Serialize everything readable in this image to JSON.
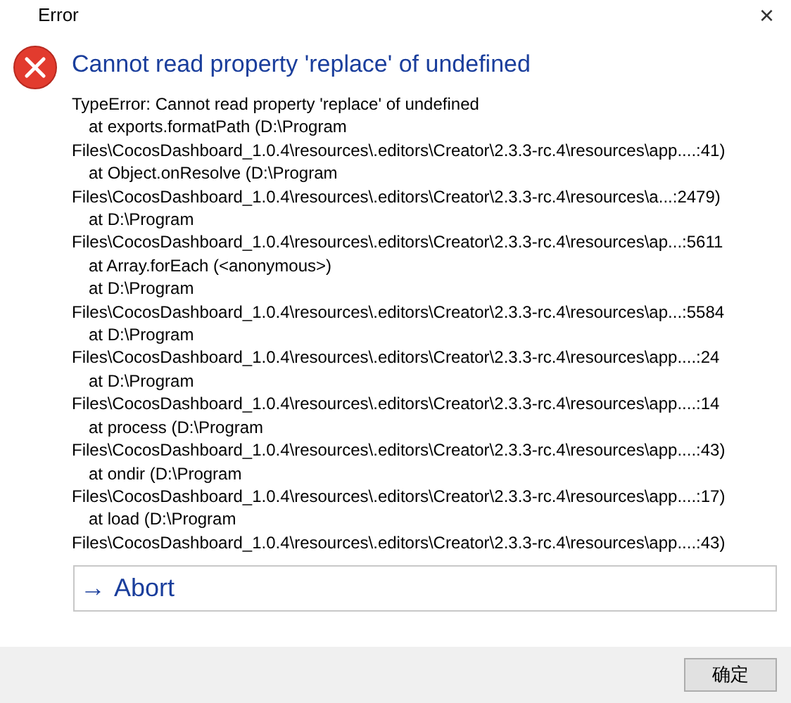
{
  "window": {
    "title": "Error",
    "close": "×"
  },
  "heading": "Cannot read property 'replace' of undefined",
  "details": [
    {
      "kind": "message",
      "text": "TypeError: Cannot read property 'replace' of undefined"
    },
    {
      "kind": "frame",
      "text": "at exports.formatPath (D:\\Program"
    },
    {
      "kind": "path",
      "text": "Files\\CocosDashboard_1.0.4\\resources\\.editors\\Creator\\2.3.3-rc.4\\resources\\app....:41)"
    },
    {
      "kind": "frame",
      "text": "at Object.onResolve (D:\\Program"
    },
    {
      "kind": "path",
      "text": "Files\\CocosDashboard_1.0.4\\resources\\.editors\\Creator\\2.3.3-rc.4\\resources\\a...:2479)"
    },
    {
      "kind": "frame",
      "text": "at D:\\Program"
    },
    {
      "kind": "path",
      "text": "Files\\CocosDashboard_1.0.4\\resources\\.editors\\Creator\\2.3.3-rc.4\\resources\\ap...:5611"
    },
    {
      "kind": "frame",
      "text": "at Array.forEach (<anonymous>)"
    },
    {
      "kind": "frame",
      "text": "at D:\\Program"
    },
    {
      "kind": "path",
      "text": "Files\\CocosDashboard_1.0.4\\resources\\.editors\\Creator\\2.3.3-rc.4\\resources\\ap...:5584"
    },
    {
      "kind": "frame",
      "text": "at D:\\Program"
    },
    {
      "kind": "path",
      "text": "Files\\CocosDashboard_1.0.4\\resources\\.editors\\Creator\\2.3.3-rc.4\\resources\\app....:24"
    },
    {
      "kind": "frame",
      "text": "at D:\\Program"
    },
    {
      "kind": "path",
      "text": "Files\\CocosDashboard_1.0.4\\resources\\.editors\\Creator\\2.3.3-rc.4\\resources\\app....:14"
    },
    {
      "kind": "frame",
      "text": "at process (D:\\Program"
    },
    {
      "kind": "path",
      "text": "Files\\CocosDashboard_1.0.4\\resources\\.editors\\Creator\\2.3.3-rc.4\\resources\\app....:43)"
    },
    {
      "kind": "frame",
      "text": "at ondir (D:\\Program"
    },
    {
      "kind": "path",
      "text": "Files\\CocosDashboard_1.0.4\\resources\\.editors\\Creator\\2.3.3-rc.4\\resources\\app....:17)"
    },
    {
      "kind": "frame",
      "text": "at load (D:\\Program"
    },
    {
      "kind": "path",
      "text": "Files\\CocosDashboard_1.0.4\\resources\\.editors\\Creator\\2.3.3-rc.4\\resources\\app....:43)"
    }
  ],
  "command": {
    "arrow": "→",
    "label": "Abort"
  },
  "buttons": [
    "确定"
  ]
}
